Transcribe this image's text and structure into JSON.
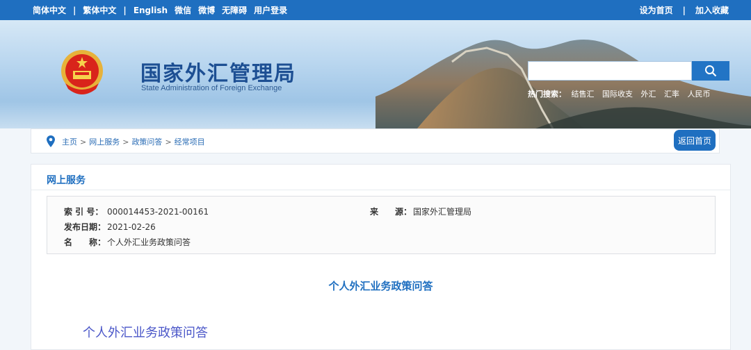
{
  "topbar": {
    "links": [
      "简体中文",
      "繁体中文",
      "English",
      "微信",
      "微博",
      "无障碍",
      "用户登录"
    ],
    "separator": "|",
    "set_home": "设为首页",
    "add_fav": "加入收藏"
  },
  "banner": {
    "title": "国家外汇管理局",
    "subtitle": "State Administration of Foreign Exchange",
    "search": {
      "placeholder": ""
    },
    "hot_label": "热门搜索：",
    "hot_keywords": [
      "结售汇",
      "国际收支",
      "外汇",
      "汇率",
      "人民币"
    ]
  },
  "breadcrumb": {
    "items": [
      "主页",
      "网上服务",
      "政策问答",
      "经常项目"
    ],
    "sep": ">",
    "back_label": "返回首页"
  },
  "panel": {
    "title": "网上服务",
    "meta": {
      "index_label": "索 引 号：",
      "index_value": "000014453-2021-00161",
      "source_label": "来　　源：",
      "source_value": "国家外汇管理局",
      "date_label": "发布日期：",
      "date_value": "2021-02-26",
      "name_label": "名　　称：",
      "name_value": "个人外汇业务政策问答"
    },
    "article_title": "个人外汇业务政策问答",
    "article_subtitle": "个人外汇业务政策问答"
  },
  "colors": {
    "brand_blue": "#1f6fc0",
    "title_blue": "#1d4f93",
    "subtitle_purple": "#4a56c8"
  }
}
